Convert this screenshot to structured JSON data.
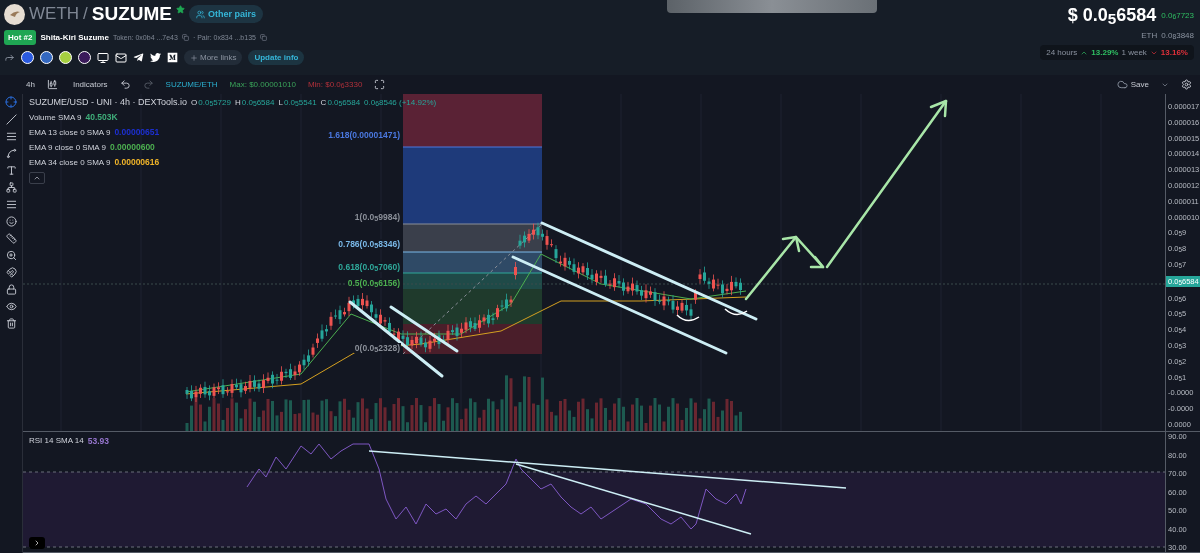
{
  "header": {
    "base": "WETH",
    "separator": "/",
    "token": "SUZUME",
    "other_pairs": "Other pairs",
    "hot_badge": "Hot #2",
    "name": "Shita-Kiri Suzume",
    "token_address": "Token: 0x0b4 ...7e43",
    "pair_address": "· Pair: 0x834 ...b135",
    "more_links": "More links",
    "update_info": "Update info"
  },
  "price": {
    "usd": "$ 0.0$_{5}$6584",
    "change": "0.0$_{6}$7723",
    "eth_label": "ETH",
    "eth": "0.0$_{8}$3848",
    "periods": [
      {
        "label": "24 hours",
        "value": "13.29%",
        "kind": "up"
      },
      {
        "label": "1 week",
        "value": "13.16%",
        "kind": "down"
      }
    ]
  },
  "toolbar": {
    "interval": "4h",
    "indicators": "Indicators",
    "pair": "SUZUME/ETH",
    "max": "Max: $0.00001010",
    "min": "Min: $0.0$_{6}$3330",
    "save": "Save"
  },
  "legend": {
    "title": "SUZUME/USD - UNI · 4h · DEXTools.io",
    "ohlc": [
      {
        "label": "O",
        "value": "0.0$_{5}$5729"
      },
      {
        "label": "H",
        "value": "0.0$_{5}$6584"
      },
      {
        "label": "L",
        "value": "0.0$_{5}$5541"
      },
      {
        "label": "C",
        "value": "0.0$_{5}$6584"
      }
    ],
    "change": "0.0$_{6}$8546 (+14.92%)",
    "indicators": [
      {
        "name": "Volume SMA 9",
        "value": "40.503K",
        "color": "#3fae7a"
      },
      {
        "name": "EMA 13 close 0 SMA 9",
        "value": "0.00000651",
        "color": "#1c2fd0"
      },
      {
        "name": "EMA 9 close 0 SMA 9",
        "value": "0.00000600",
        "color": "#4caf50"
      },
      {
        "name": "EMA 34 close 0 SMA 9",
        "value": "0.00000616",
        "color": "#f0b429"
      }
    ]
  },
  "fib_levels": [
    {
      "label": "1.618(0.00001471)",
      "color": "#4a78e0"
    },
    {
      "label": "1(0.0$_{5}$9984)",
      "color": "#8a8f98"
    },
    {
      "label": "0.786(0.0$_{5}$8346)",
      "color": "#7ab8e8"
    },
    {
      "label": "0.618(0.0$_{5}$7060)",
      "color": "#2fa89a"
    },
    {
      "label": "0.5(0.0$_{5}$6156)",
      "color": "#4caf50"
    },
    {
      "label": "0(0.0$_{5}$2328)",
      "color": "#8a8f98"
    }
  ],
  "price_axis": [
    "0.000017",
    "0.000016",
    "0.000015",
    "0.000014",
    "0.000013",
    "0.000012",
    "0.000011",
    "0.000010",
    "0.0$_{5}$9",
    "0.0$_{5}$8",
    "0.0$_{5}$7",
    "0.0$_{5}$6",
    "0.0$_{5}$5",
    "0.0$_{5}$4",
    "0.0$_{5}$3",
    "0.0$_{5}$2",
    "0.0$_{5}$1",
    "-0.0000",
    "-0.0000",
    "0.0000"
  ],
  "current_price": "0.0$_{5}$6584",
  "rsi": {
    "label": "RSI 14 SMA 14",
    "value": "53.93",
    "axis": [
      "90.00",
      "80.00",
      "70.00",
      "60.00",
      "50.00",
      "40.00",
      "30.00"
    ]
  }
}
